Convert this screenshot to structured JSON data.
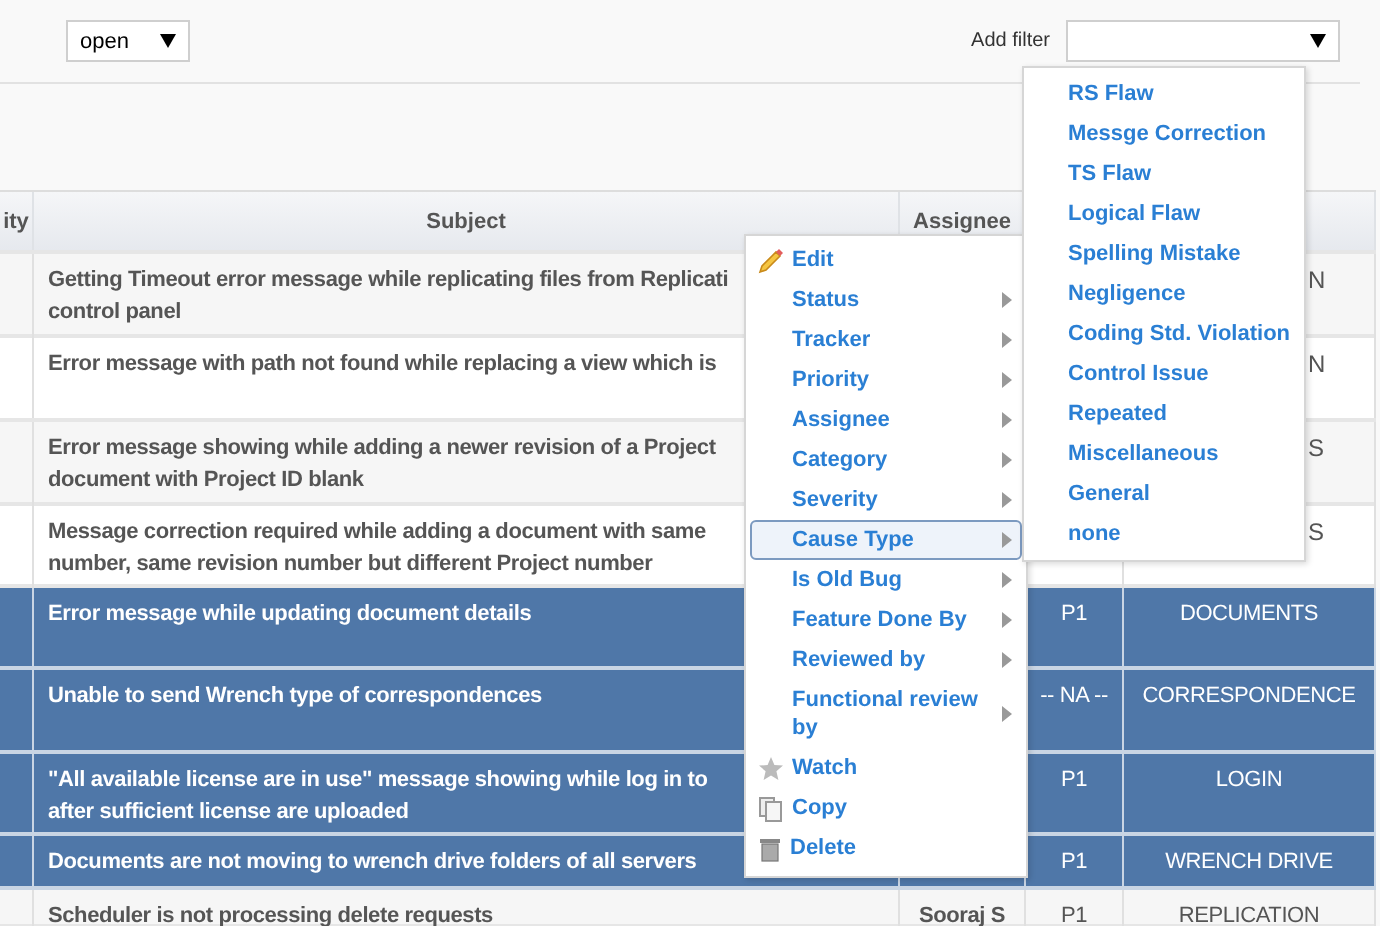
{
  "status_filter": {
    "value": "open"
  },
  "add_filter": {
    "label": "Add filter"
  },
  "table": {
    "columns": [
      "ity",
      "Subject",
      "Assignee"
    ],
    "rows": [
      {
        "selected": false,
        "subject": [
          "Getting Timeout error message while replicating files from Replicati",
          "control panel"
        ],
        "category": "N"
      },
      {
        "selected": false,
        "subject": [
          "Error message with path not found while replacing a view which is"
        ],
        "category": "N"
      },
      {
        "selected": false,
        "subject": [
          "Error message showing while adding a newer revision of a Project",
          "document with Project ID blank"
        ],
        "category": "S"
      },
      {
        "selected": false,
        "subject": [
          "Message correction required while adding a document with same",
          "number, same revision number but different Project number"
        ],
        "category": "S"
      },
      {
        "selected": true,
        "subject": [
          "Error message while updating document details"
        ],
        "priority": "P1",
        "category": "DOCUMENTS"
      },
      {
        "selected": true,
        "subject": [
          "Unable to send Wrench type of correspondences"
        ],
        "priority": "-- NA --",
        "category": "CORRESPONDENCE"
      },
      {
        "selected": true,
        "subject": [
          "\"All available license are in use\" message showing while log in to",
          "after sufficient license are uploaded"
        ],
        "priority": "P1",
        "category": "LOGIN"
      },
      {
        "selected": true,
        "subject": [
          "Documents are not moving to wrench drive folders of all servers"
        ],
        "priority": "P1",
        "category": "WRENCH DRIVE"
      },
      {
        "selected": false,
        "subject": [
          "Scheduler is not processing delete requests"
        ],
        "assignee": "Sooraj S",
        "priority": "P1",
        "category": "REPLICATION"
      }
    ]
  },
  "context_menu": [
    {
      "label": "Edit",
      "kind": "action",
      "selected": false
    },
    {
      "label": "Status",
      "kind": "submenu",
      "selected": false
    },
    {
      "label": "Tracker",
      "kind": "submenu",
      "selected": false
    },
    {
      "label": "Priority",
      "kind": "submenu",
      "selected": false
    },
    {
      "label": "Assignee",
      "kind": "submenu",
      "selected": false
    },
    {
      "label": "Category",
      "kind": "submenu",
      "selected": false
    },
    {
      "label": "Severity",
      "kind": "submenu",
      "selected": false
    },
    {
      "label": "Cause Type",
      "kind": "submenu",
      "selected": true
    },
    {
      "label": "Is Old Bug",
      "kind": "submenu",
      "selected": false
    },
    {
      "label": "Feature Done By",
      "kind": "submenu",
      "selected": false
    },
    {
      "label": "Reviewed by",
      "kind": "submenu",
      "selected": false
    },
    {
      "label": "Functional review by",
      "kind": "submenu",
      "selected": false
    },
    {
      "label": "Watch",
      "kind": "action",
      "selected": false
    },
    {
      "label": "Copy",
      "kind": "action",
      "selected": false
    },
    {
      "label": "Delete",
      "kind": "action",
      "selected": false
    }
  ],
  "cause_type_submenu": [
    "RS Flaw",
    "Messge Correction",
    "TS Flaw",
    "Logical Flaw",
    "Spelling Mistake",
    "Negligence",
    "Coding Std. Violation",
    "Control Issue",
    "Repeated",
    "Miscellaneous",
    "General",
    "none"
  ]
}
